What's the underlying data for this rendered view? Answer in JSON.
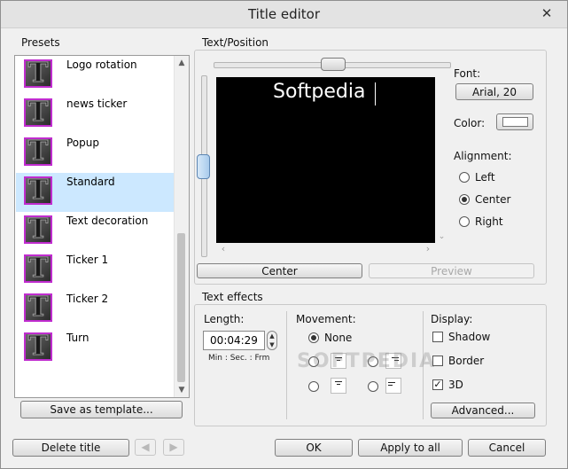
{
  "window": {
    "title": "Title editor",
    "close_glyph": "✕"
  },
  "presets": {
    "label": "Presets",
    "items": [
      {
        "label": "Logo rotation"
      },
      {
        "label": "news ticker"
      },
      {
        "label": "Popup"
      },
      {
        "label": "Standard",
        "selected": true
      },
      {
        "label": "Text decoration"
      },
      {
        "label": "Ticker 1"
      },
      {
        "label": "Ticker 2"
      },
      {
        "label": "Turn"
      }
    ],
    "icon_glyph": "T",
    "save_button": "Save as template..."
  },
  "text_position": {
    "label": "Text/Position",
    "preview_text": "Softpedia",
    "center_button": "Center",
    "preview_button": "Preview",
    "font_label": "Font:",
    "font_value": "Arial, 20",
    "color_label": "Color:",
    "color_value": "#ffffff",
    "alignment_label": "Alignment:",
    "alignment_options": [
      "Left",
      "Center",
      "Right"
    ],
    "alignment_selected": "Center"
  },
  "text_effects": {
    "label": "Text effects",
    "length_label": "Length:",
    "length_value": "00:04:29",
    "length_format": "Min : Sec. : Frm",
    "movement_label": "Movement:",
    "movement_none": "None",
    "display_label": "Display:",
    "display_options": [
      {
        "label": "Shadow",
        "checked": false
      },
      {
        "label": "Border",
        "checked": false
      },
      {
        "label": "3D",
        "checked": true
      }
    ],
    "advanced_button": "Advanced..."
  },
  "footer": {
    "delete_button": "Delete title",
    "ok_button": "OK",
    "apply_all_button": "Apply to all",
    "cancel_button": "Cancel"
  },
  "watermark": "SOFTPEDIA",
  "icons": {
    "prev": "arrow-left-icon",
    "next": "arrow-right-icon"
  }
}
